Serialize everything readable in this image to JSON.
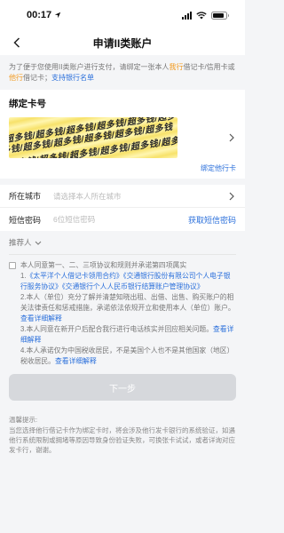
{
  "status_bar": {
    "time": "00:17"
  },
  "nav": {
    "title": "申请II类账户"
  },
  "intro": {
    "part1": "为了便于您使用II类账户进行支付，请绑定一张本人",
    "highlight1": "我行",
    "part2": "借记卡/信用卡或",
    "highlight2": "他行",
    "part3": "借记卡；",
    "link": "支持银行名单"
  },
  "card_section": {
    "title": "绑定卡号",
    "watermark": "超多钱/超多钱/超多钱/超多钱/超多钱/超多钱",
    "bind_other": "绑定他行卡"
  },
  "form": {
    "city_label": "所在城市",
    "city_placeholder": "请选择本人所在城市",
    "sms_label": "短信密码",
    "sms_placeholder": "6位短信密码",
    "get_sms": "获取短信密码"
  },
  "referrer": {
    "label": "推荐人"
  },
  "agreement": {
    "intro": "本人同意第一、二、三项协议和规则并承诺第四项属实",
    "item1_prefix": "1.",
    "item1_links": "《太平洋个人借记卡领用合约》《交通银行股份有限公司个人电子银行服务协议》《交通银行个人人民币银行结算账户管理协议》",
    "item2": "2.本人（单位）充分了解并清楚知晓出租、出借、出售、购买账户的相关法律责任和惩戒措施，承诺依法依规开立和使用本人（单位）账户。",
    "item2_link": "查看详细解释",
    "item3": "3.本人同意在新开户后配合我行进行电话核实并回应相关问题。",
    "item3_link": "查看详细解释",
    "item4": "4.本人承诺仅为中国税收居民，不是美国个人也不是其他国家（地区）税收居民。",
    "item4_link": "查看详细解释"
  },
  "next_button": {
    "label": "下一步"
  },
  "tips": {
    "title": "温馨提示:",
    "text": "当您选择他行借记卡作为绑定卡时，将会涉及他行发卡银行的系统验证，如遇他行系统限制或拥堵等原因导致身份验证失败，可换张卡试试，或者详询对应发卡行，谢谢。"
  },
  "colors": {
    "link": "#2a6fdb",
    "highlight": "#f29a1e",
    "background": "#f4f5f7"
  }
}
